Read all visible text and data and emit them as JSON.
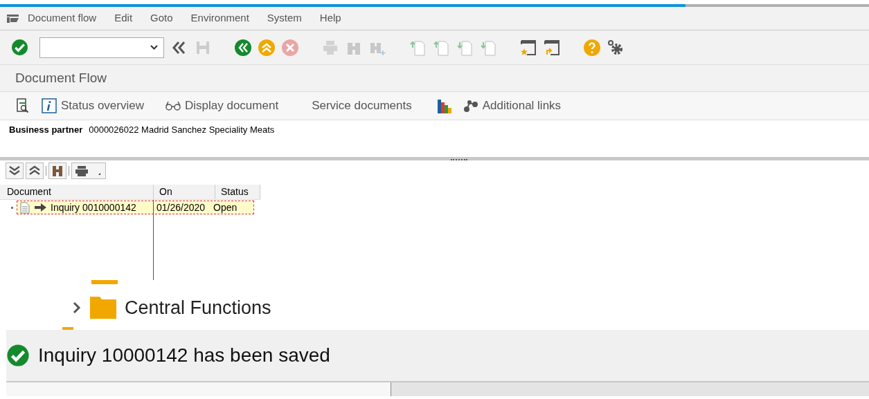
{
  "menu_bar": {
    "items": [
      "Document flow",
      "Edit",
      "Goto",
      "Environment",
      "System",
      "Help"
    ]
  },
  "screen_title": "Document Flow",
  "app_toolbar": {
    "buttons": [
      {
        "kind": "icon"
      },
      {
        "kind": "text_icon",
        "label": "Status overview"
      },
      {
        "kind": "glasses",
        "label": "Display document"
      },
      {
        "kind": "text",
        "label": "Service documents"
      },
      {
        "kind": "chart"
      },
      {
        "kind": "links",
        "label": "Additional links"
      }
    ]
  },
  "business_partner": {
    "label": "Business partner",
    "value": "0000026022 Madrid Sanchez Speciality Meats"
  },
  "table": {
    "columns": [
      "Document",
      "On",
      "Status"
    ],
    "rows": [
      {
        "document": "Inquiry 0010000142",
        "on": "01/26/2020",
        "status": "Open",
        "selected": true
      }
    ]
  },
  "tree_fragment": {
    "items": [
      {
        "label": "Central Functions",
        "expanded": false
      }
    ]
  },
  "status_bar": {
    "message": "Inquiry 10000142 has been saved",
    "success": true
  }
}
